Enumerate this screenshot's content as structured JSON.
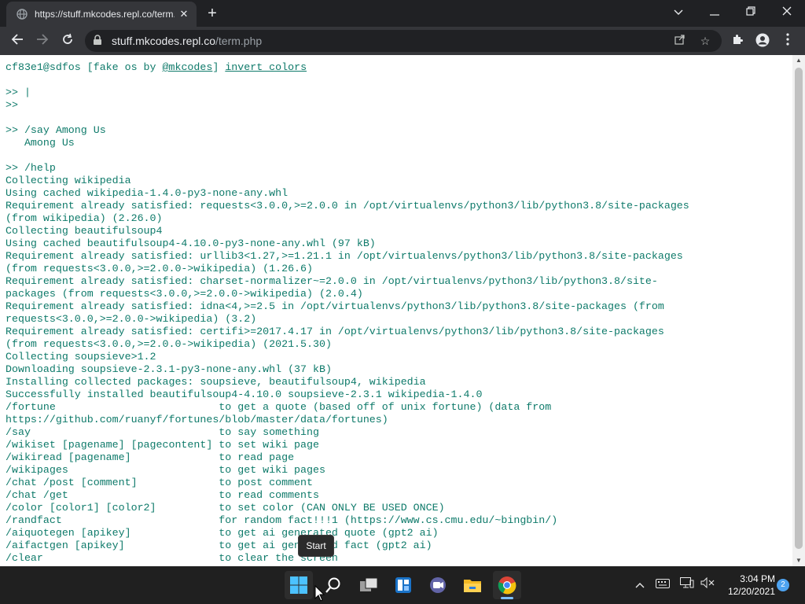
{
  "browser": {
    "tab_title": "https://stuff.mkcodes.repl.co/term.php",
    "url_host": "stuff.mkcodes.repl.co",
    "url_path": "/term.php"
  },
  "terminal": {
    "header_prefix": "cf83e1@sdfos [fake os by ",
    "header_link": "@mkcodes",
    "header_mid": "] ",
    "header_invert": "invert colors",
    "lines": [
      "",
      ">> |",
      ">>",
      "",
      ">> /say Among Us",
      "   Among Us",
      "",
      ">> /help",
      "Collecting wikipedia",
      "Using cached wikipedia-1.4.0-py3-none-any.whl",
      "Requirement already satisfied: requests<3.0.0,>=2.0.0 in /opt/virtualenvs/python3/lib/python3.8/site-packages",
      "(from wikipedia) (2.26.0)",
      "Collecting beautifulsoup4",
      "Using cached beautifulsoup4-4.10.0-py3-none-any.whl (97 kB)",
      "Requirement already satisfied: urllib3<1.27,>=1.21.1 in /opt/virtualenvs/python3/lib/python3.8/site-packages",
      "(from requests<3.0.0,>=2.0.0->wikipedia) (1.26.6)",
      "Requirement already satisfied: charset-normalizer~=2.0.0 in /opt/virtualenvs/python3/lib/python3.8/site-",
      "packages (from requests<3.0.0,>=2.0.0->wikipedia) (2.0.4)",
      "Requirement already satisfied: idna<4,>=2.5 in /opt/virtualenvs/python3/lib/python3.8/site-packages (from",
      "requests<3.0.0,>=2.0.0->wikipedia) (3.2)",
      "Requirement already satisfied: certifi>=2017.4.17 in /opt/virtualenvs/python3/lib/python3.8/site-packages",
      "(from requests<3.0.0,>=2.0.0->wikipedia) (2021.5.30)",
      "Collecting soupsieve>1.2",
      "Downloading soupsieve-2.3.1-py3-none-any.whl (37 kB)",
      "Installing collected packages: soupsieve, beautifulsoup4, wikipedia",
      "Successfully installed beautifulsoup4-4.10.0 soupsieve-2.3.1 wikipedia-1.4.0",
      "/fortune                          to get a quote (based off of unix fortune) (data from",
      "https://github.com/ruanyf/fortunes/blob/master/data/fortunes)",
      "/say                              to say something",
      "/wikiset [pagename] [pagecontent] to set wiki page",
      "/wikiread [pagename]              to read page",
      "/wikipages                        to get wiki pages",
      "/chat /post [comment]             to post comment",
      "/chat /get                        to read comments",
      "/color [color1] [color2]          to set color (CAN ONLY BE USED ONCE)",
      "/randfact                         for random fact!!!1 (https://www.cs.cmu.edu/~bingbin/)",
      "/aiquotegen [apikey]              to get ai generated quote (gpt2 ai)",
      "/aifactgen [apikey]               to get ai generated fact (gpt2 ai)",
      "/clear                            to clear the screen"
    ]
  },
  "tooltip": "Start",
  "taskbar": {
    "time": "3:04 PM",
    "date": "12/20/2021",
    "notifications": "2"
  },
  "colors": {
    "terminal_text": "#0e7a6a",
    "accent": "#4ea3f0"
  }
}
